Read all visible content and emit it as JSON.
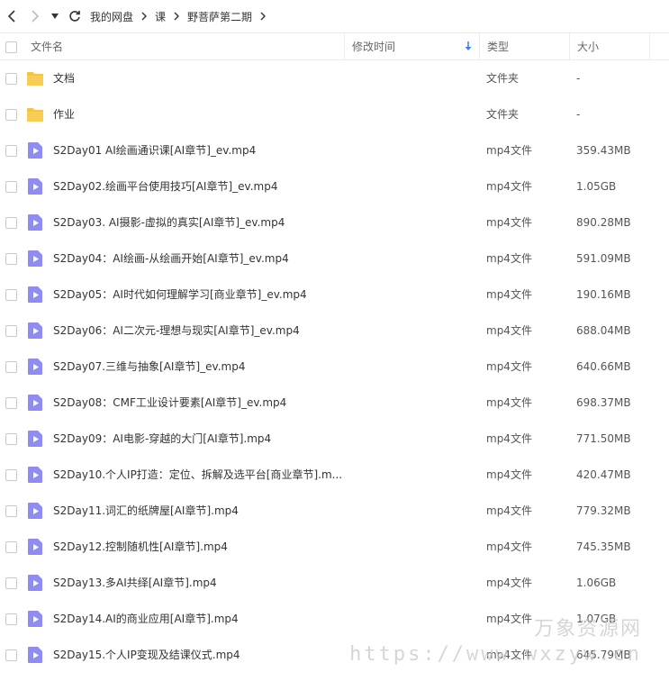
{
  "breadcrumb": [
    "我的网盘",
    "课",
    "野菩萨第二期"
  ],
  "columns": {
    "name": "文件名",
    "modified": "修改时间",
    "type": "类型",
    "size": "大小"
  },
  "colors": {
    "folder": "#f5c242",
    "video": "#8f8cf0",
    "sort_arrow": "#3a7cf7"
  },
  "files": [
    {
      "name": "文档",
      "type": "文件夹",
      "size": "-",
      "icon": "folder-icon"
    },
    {
      "name": "作业",
      "type": "文件夹",
      "size": "-",
      "icon": "folder-icon"
    },
    {
      "name": "S2Day01 AI绘画通识课[AI章节]_ev.mp4",
      "type": "mp4文件",
      "size": "359.43MB",
      "icon": "video-file-icon"
    },
    {
      "name": "S2Day02.绘画平台使用技巧[AI章节]_ev.mp4",
      "type": "mp4文件",
      "size": "1.05GB",
      "icon": "video-file-icon"
    },
    {
      "name": "S2Day03. AI摄影-虚拟的真实[AI章节]_ev.mp4",
      "type": "mp4文件",
      "size": "890.28MB",
      "icon": "video-file-icon"
    },
    {
      "name": "S2Day04：AI绘画-从绘画开始[AI章节]_ev.mp4",
      "type": "mp4文件",
      "size": "591.09MB",
      "icon": "video-file-icon"
    },
    {
      "name": "S2Day05：AI时代如何理解学习[商业章节]_ev.mp4",
      "type": "mp4文件",
      "size": "190.16MB",
      "icon": "video-file-icon"
    },
    {
      "name": "S2Day06：AI二次元-理想与现实[AI章节]_ev.mp4",
      "type": "mp4文件",
      "size": "688.04MB",
      "icon": "video-file-icon"
    },
    {
      "name": "S2Day07.三维与抽象[AI章节]_ev.mp4",
      "type": "mp4文件",
      "size": "640.66MB",
      "icon": "video-file-icon"
    },
    {
      "name": "S2Day08：CMF工业设计要素[AI章节]_ev.mp4",
      "type": "mp4文件",
      "size": "698.37MB",
      "icon": "video-file-icon"
    },
    {
      "name": "S2Day09：AI电影-穿越的大门[AI章节].mp4",
      "type": "mp4文件",
      "size": "771.50MB",
      "icon": "video-file-icon"
    },
    {
      "name": "S2Day10.个人IP打造：定位、拆解及选平台[商业章节].m...",
      "type": "mp4文件",
      "size": "420.47MB",
      "icon": "video-file-icon"
    },
    {
      "name": "S2Day11.词汇的纸牌屋[AI章节].mp4",
      "type": "mp4文件",
      "size": "779.32MB",
      "icon": "video-file-icon"
    },
    {
      "name": "S2Day12.控制随机性[AI章节].mp4",
      "type": "mp4文件",
      "size": "745.35MB",
      "icon": "video-file-icon"
    },
    {
      "name": "S2Day13.多AI共绎[AI章节].mp4",
      "type": "mp4文件",
      "size": "1.06GB",
      "icon": "video-file-icon"
    },
    {
      "name": "S2Day14.AI的商业应用[AI章节].mp4",
      "type": "mp4文件",
      "size": "1.07GB",
      "icon": "video-file-icon"
    },
    {
      "name": "S2Day15.个人IP变现及结课仪式.mp4",
      "type": "mp4文件",
      "size": "645.79MB",
      "icon": "video-file-icon"
    }
  ],
  "watermark": {
    "line1": "万象资源网",
    "line2": "https://www.wxzyw.cn"
  }
}
